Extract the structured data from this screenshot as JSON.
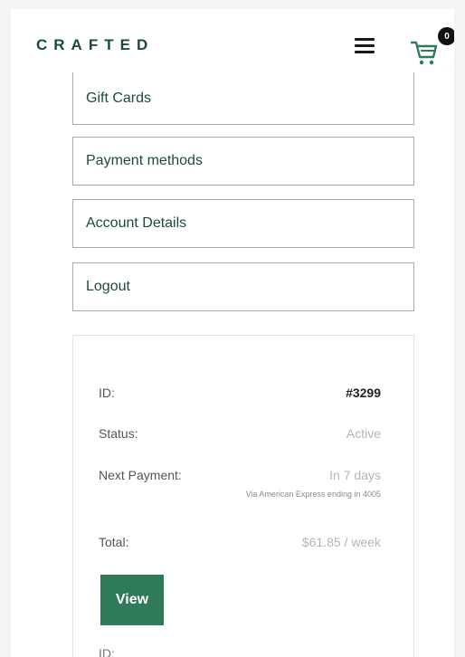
{
  "header": {
    "brand": "CRAFTED",
    "cart_count": "0"
  },
  "nav": {
    "items": [
      {
        "label": "Gift Cards"
      },
      {
        "label": "Payment methods"
      },
      {
        "label": "Account Details"
      },
      {
        "label": "Logout"
      }
    ]
  },
  "subscription": {
    "id_label": "ID:",
    "id_value": "#3299",
    "status_label": "Status:",
    "status_value": "Active",
    "next_payment_label": "Next Payment:",
    "next_payment_value": "In 7 days",
    "payment_note": "Via American Express ending in 4005",
    "total_label": "Total:",
    "total_value": "$61.85 / week",
    "view_label": "View",
    "next_id_label": "ID:"
  },
  "colors": {
    "brand": "#1e4a39",
    "button": "#2f7a58",
    "border": "#a9a9a9"
  }
}
